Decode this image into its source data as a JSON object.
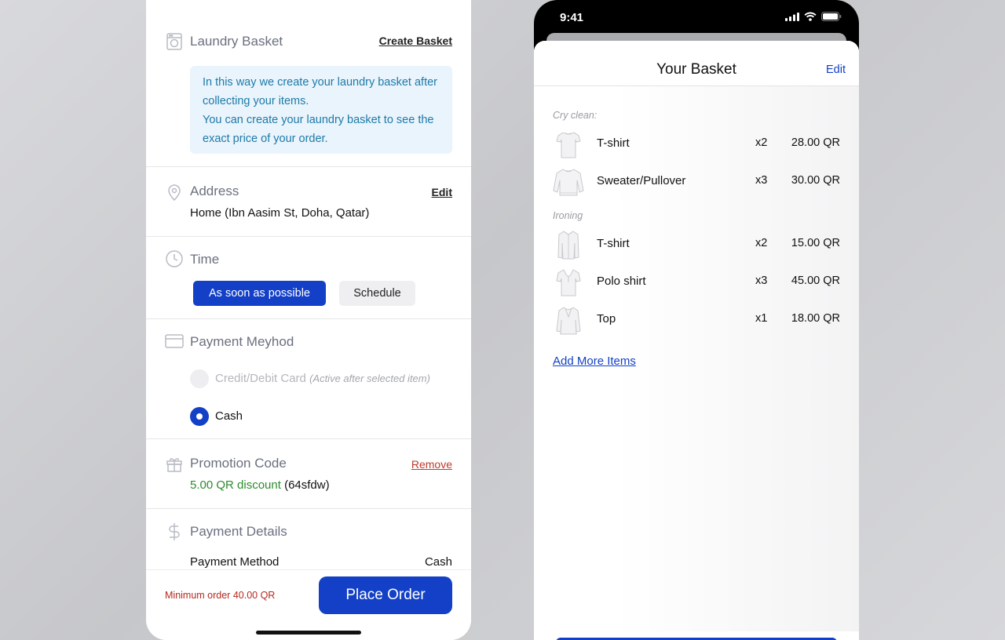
{
  "checkout": {
    "basket": {
      "title": "Laundry Basket",
      "action": "Create Basket",
      "info_line1": "In this way we create your laundry basket after collecting your items.",
      "info_line2": "You can create your laundry basket to see the exact price of your order."
    },
    "address": {
      "title": "Address",
      "action": "Edit",
      "value": "Home (Ibn Aasim St, Doha, Qatar)"
    },
    "time": {
      "title": "Time",
      "option_asap": "As soon as possible",
      "option_schedule": "Schedule"
    },
    "payment_method": {
      "title": "Payment Meyhod",
      "card_label": "Credit/Debit Card",
      "card_note": "(Active after selected item)",
      "cash_label": "Cash"
    },
    "promotion": {
      "title": "Promotion Code",
      "action": "Remove",
      "discount": "5.00 QR discount",
      "code": "(64sfdw)"
    },
    "payment_details": {
      "title": "Payment Details",
      "method_label": "Payment Method",
      "method_value": "Cash"
    },
    "footer": {
      "min_order": "Minimum order 40.00 QR",
      "place_order": "Place Order"
    }
  },
  "phone": {
    "status_time": "9:41",
    "sheet_title": "Your Basket",
    "sheet_edit": "Edit",
    "categories": [
      {
        "label": "Cry clean:",
        "items": [
          {
            "name": "T-shirt",
            "qty": "x2",
            "price": "28.00 QR",
            "icon": "tshirt-icon"
          },
          {
            "name": "Sweater/Pullover",
            "qty": "x3",
            "price": "30.00 QR",
            "icon": "sweater-icon"
          }
        ]
      },
      {
        "label": "Ironing",
        "items": [
          {
            "name": "T-shirt",
            "qty": "x2",
            "price": "15.00 QR",
            "icon": "dress-shirt-icon"
          },
          {
            "name": "Polo shirt",
            "qty": "x3",
            "price": "45.00 QR",
            "icon": "polo-shirt-icon"
          },
          {
            "name": "Top",
            "qty": "x1",
            "price": "18.00 QR",
            "icon": "blouse-icon"
          }
        ]
      }
    ],
    "add_more": "Add More Items"
  },
  "colors": {
    "primary": "#1340c6",
    "info_bg": "#eaf4fc",
    "info_text": "#1d7aa8",
    "danger": "#c0392b",
    "success": "#2d8a2d"
  }
}
